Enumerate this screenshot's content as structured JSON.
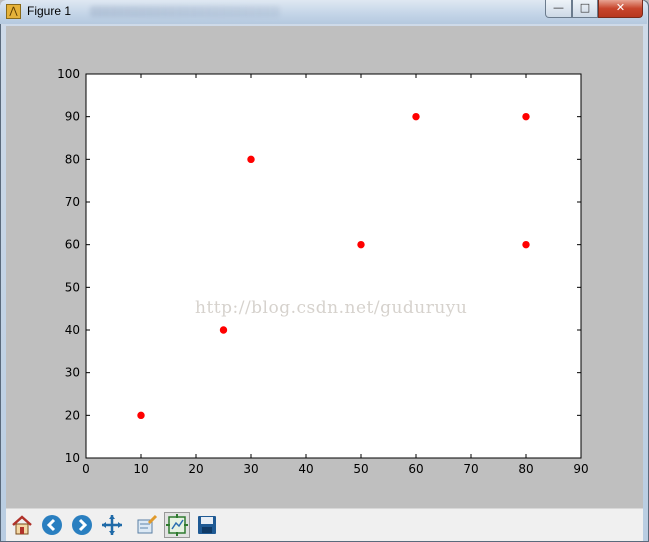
{
  "window": {
    "title": "Figure 1",
    "controls": {
      "minimize": "—",
      "maximize": "□",
      "close": "✕"
    }
  },
  "toolbar": {
    "buttons": [
      {
        "name": "home",
        "icon": "home-icon"
      },
      {
        "name": "back",
        "icon": "back-arrow-icon"
      },
      {
        "name": "forward",
        "icon": "forward-arrow-icon"
      },
      {
        "name": "pan",
        "icon": "pan-arrows-icon"
      },
      {
        "name": "zoom",
        "icon": "zoom-rect-icon"
      },
      {
        "name": "subplots",
        "icon": "subplots-config-icon"
      },
      {
        "name": "save",
        "icon": "floppy-disk-icon"
      }
    ]
  },
  "watermark": "http://blog.csdn.net/guduruyu",
  "chart_data": {
    "type": "scatter",
    "title": "",
    "xlabel": "",
    "ylabel": "",
    "xlim": [
      0,
      90
    ],
    "ylim": [
      10,
      100
    ],
    "xticks": [
      0,
      10,
      20,
      30,
      40,
      50,
      60,
      70,
      80,
      90
    ],
    "yticks": [
      10,
      20,
      30,
      40,
      50,
      60,
      70,
      80,
      90,
      100
    ],
    "grid": false,
    "legend": "none",
    "series": [
      {
        "marker_color": "#ff0000",
        "x": [
          10,
          25,
          30,
          50,
          60,
          80,
          80
        ],
        "y": [
          20,
          40,
          80,
          60,
          90,
          90,
          60
        ]
      }
    ]
  }
}
